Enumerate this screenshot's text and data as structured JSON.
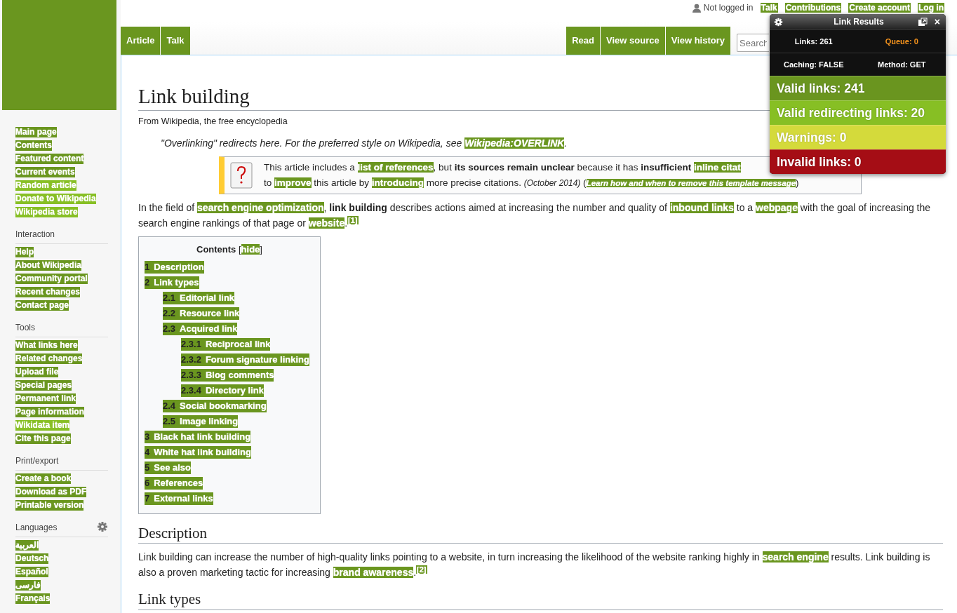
{
  "personal_bar": {
    "user": "Not logged in",
    "links": [
      "Talk",
      "Contributions",
      "Create account",
      "Log in"
    ]
  },
  "left_tabs": [
    {
      "label": "Article"
    },
    {
      "label": "Talk"
    }
  ],
  "right_tabs": [
    {
      "label": "Read"
    },
    {
      "label": "View source"
    },
    {
      "label": "View history"
    }
  ],
  "search": {
    "placeholder": "Search"
  },
  "sidebar": {
    "sections": [
      {
        "items": [
          {
            "label": "Main page",
            "redirect": false
          },
          {
            "label": "Contents",
            "redirect": false
          },
          {
            "label": "Featured content",
            "redirect": false
          },
          {
            "label": "Current events",
            "redirect": false
          },
          {
            "label": "Random article",
            "redirect": true
          },
          {
            "label": "Donate to Wikipedia",
            "redirect": true
          },
          {
            "label": "Wikipedia store",
            "redirect": true
          }
        ]
      },
      {
        "heading": "Interaction",
        "items": [
          {
            "label": "Help",
            "redirect": false
          },
          {
            "label": "About Wikipedia",
            "redirect": false
          },
          {
            "label": "Community portal",
            "redirect": false
          },
          {
            "label": "Recent changes",
            "redirect": false
          },
          {
            "label": "Contact page",
            "redirect": false
          }
        ]
      },
      {
        "heading": "Tools",
        "items": [
          {
            "label": "What links here",
            "redirect": false
          },
          {
            "label": "Related changes",
            "redirect": false
          },
          {
            "label": "Upload file",
            "redirect": false
          },
          {
            "label": "Special pages",
            "redirect": false
          },
          {
            "label": "Permanent link",
            "redirect": false
          },
          {
            "label": "Page information",
            "redirect": false
          },
          {
            "label": "Wikidata item",
            "redirect": true
          },
          {
            "label": "Cite this page",
            "redirect": false
          }
        ]
      },
      {
        "heading": "Print/export",
        "items": [
          {
            "label": "Create a book",
            "redirect": false
          },
          {
            "label": "Download as PDF",
            "redirect": false
          },
          {
            "label": "Printable version",
            "redirect": false
          }
        ]
      },
      {
        "heading": "Languages",
        "settings": true,
        "items": [
          {
            "label": "العربية",
            "redirect": false
          },
          {
            "label": "Deutsch",
            "redirect": false
          },
          {
            "label": "Español",
            "redirect": false
          },
          {
            "label": "فارسی",
            "redirect": false
          },
          {
            "label": "Français",
            "redirect": false
          }
        ]
      }
    ]
  },
  "article": {
    "title": "Link building",
    "tagline": "From Wikipedia, the free encyclopedia",
    "hatnote": [
      {
        "kind": "text",
        "text": "\"Overlinking\" redirects here. For the preferred style on Wikipedia, see "
      },
      {
        "kind": "link",
        "text": "Wikipedia:OVERLINK"
      },
      {
        "kind": "text",
        "text": "."
      }
    ],
    "notice": {
      "lines": [
        [
          {
            "kind": "text",
            "text": "This article includes a "
          },
          {
            "kind": "link",
            "text": "list of references"
          },
          {
            "kind": "text",
            "text": ", but "
          },
          {
            "kind": "bold",
            "text": "its sources remain unclear"
          },
          {
            "kind": "text",
            "text": " because it has "
          },
          {
            "kind": "bold",
            "text": "insufficient "
          },
          {
            "kind": "link",
            "text": "inline citat"
          }
        ],
        [
          {
            "kind": "text",
            "text": "to "
          },
          {
            "kind": "link",
            "text": "improve"
          },
          {
            "kind": "text",
            "text": " this article by "
          },
          {
            "kind": "link",
            "text": "introducing"
          },
          {
            "kind": "text",
            "text": " more precise citations. "
          },
          {
            "kind": "note",
            "text": "(October 2014)"
          },
          {
            "kind": "text",
            "text": " ("
          },
          {
            "kind": "small_link",
            "text": "Learn how and when to remove this template message"
          },
          {
            "kind": "text",
            "text": ")"
          }
        ]
      ]
    },
    "intro": [
      {
        "kind": "text",
        "text": "In the field of "
      },
      {
        "kind": "link",
        "text": "search engine optimization"
      },
      {
        "kind": "text",
        "text": ", "
      },
      {
        "kind": "bold",
        "text": "link building"
      },
      {
        "kind": "text",
        "text": " describes actions aimed at increasing the number and quality of "
      },
      {
        "kind": "link",
        "text": "inbound links"
      },
      {
        "kind": "text",
        "text": " to a "
      },
      {
        "kind": "link",
        "text": "webpage"
      },
      {
        "kind": "text",
        "text": " with the goal of increasing the search engine rankings of that page or "
      },
      {
        "kind": "link",
        "text": "website"
      },
      {
        "kind": "text",
        "text": "."
      },
      {
        "kind": "ref",
        "text": "[1]"
      }
    ],
    "toc": {
      "title": "Contents",
      "toggle_open": "[",
      "toggle": "hide",
      "toggle_close": "]",
      "items": [
        {
          "number": "1",
          "label": "Description"
        },
        {
          "number": "2",
          "label": "Link types",
          "children": [
            {
              "number": "2.1",
              "label": "Editorial link"
            },
            {
              "number": "2.2",
              "label": "Resource link"
            },
            {
              "number": "2.3",
              "label": "Acquired link",
              "children": [
                {
                  "number": "2.3.1",
                  "label": "Reciprocal link"
                },
                {
                  "number": "2.3.2",
                  "label": "Forum signature linking"
                },
                {
                  "number": "2.3.3",
                  "label": "Blog comments"
                },
                {
                  "number": "2.3.4",
                  "label": "Directory link"
                }
              ]
            },
            {
              "number": "2.4",
              "label": "Social bookmarking"
            },
            {
              "number": "2.5",
              "label": "Image linking"
            }
          ]
        },
        {
          "number": "3",
          "label": "Black hat link building"
        },
        {
          "number": "4",
          "label": "White hat link building"
        },
        {
          "number": "5",
          "label": "See also"
        },
        {
          "number": "6",
          "label": "References"
        },
        {
          "number": "7",
          "label": "External links"
        }
      ]
    },
    "sections": [
      {
        "heading": "Description",
        "body": [
          {
            "kind": "text",
            "text": "Link building can increase the number of high-quality links pointing to a website, in turn increasing the likelihood of the website ranking highly in "
          },
          {
            "kind": "link",
            "text": "search engine"
          },
          {
            "kind": "text",
            "text": " results. Link building is also a proven marketing tactic for increasing "
          },
          {
            "kind": "link",
            "text": "brand awareness"
          },
          {
            "kind": "text",
            "text": "."
          },
          {
            "kind": "ref",
            "text": "[2]"
          }
        ]
      },
      {
        "heading": "Link types"
      }
    ]
  },
  "popup": {
    "title": "Link Results",
    "close": "×",
    "stats": [
      {
        "label": "Links: 261",
        "highlight": false
      },
      {
        "label": "Queue: 0",
        "highlight": true
      },
      {
        "label": "Caching: FALSE",
        "highlight": false
      },
      {
        "label": "Method: GET",
        "highlight": false
      }
    ],
    "results": [
      {
        "label": "Valid links: 241",
        "color": "#6a951f"
      },
      {
        "label": "Valid redirecting links: 20",
        "color": "#87bf24"
      },
      {
        "label": "Warnings: 0",
        "color": "#d4da3b"
      },
      {
        "label": "Invalid links: 0",
        "color": "#a50d15"
      }
    ]
  }
}
